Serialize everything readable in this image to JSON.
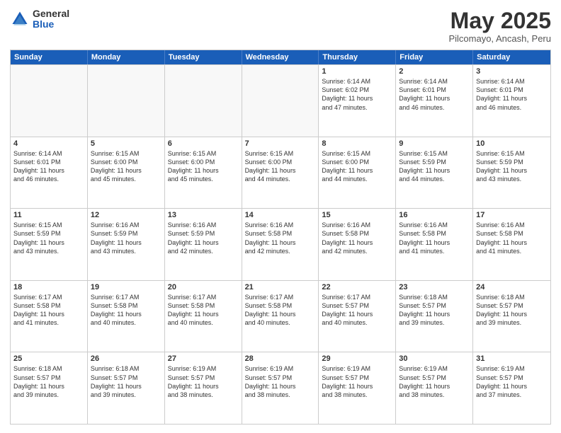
{
  "logo": {
    "general": "General",
    "blue": "Blue"
  },
  "title": "May 2025",
  "subtitle": "Pilcomayo, Ancash, Peru",
  "headers": [
    "Sunday",
    "Monday",
    "Tuesday",
    "Wednesday",
    "Thursday",
    "Friday",
    "Saturday"
  ],
  "weeks": [
    [
      {
        "day": "",
        "text": ""
      },
      {
        "day": "",
        "text": ""
      },
      {
        "day": "",
        "text": ""
      },
      {
        "day": "",
        "text": ""
      },
      {
        "day": "1",
        "text": "Sunrise: 6:14 AM\nSunset: 6:02 PM\nDaylight: 11 hours\nand 47 minutes."
      },
      {
        "day": "2",
        "text": "Sunrise: 6:14 AM\nSunset: 6:01 PM\nDaylight: 11 hours\nand 46 minutes."
      },
      {
        "day": "3",
        "text": "Sunrise: 6:14 AM\nSunset: 6:01 PM\nDaylight: 11 hours\nand 46 minutes."
      }
    ],
    [
      {
        "day": "4",
        "text": "Sunrise: 6:14 AM\nSunset: 6:01 PM\nDaylight: 11 hours\nand 46 minutes."
      },
      {
        "day": "5",
        "text": "Sunrise: 6:15 AM\nSunset: 6:00 PM\nDaylight: 11 hours\nand 45 minutes."
      },
      {
        "day": "6",
        "text": "Sunrise: 6:15 AM\nSunset: 6:00 PM\nDaylight: 11 hours\nand 45 minutes."
      },
      {
        "day": "7",
        "text": "Sunrise: 6:15 AM\nSunset: 6:00 PM\nDaylight: 11 hours\nand 44 minutes."
      },
      {
        "day": "8",
        "text": "Sunrise: 6:15 AM\nSunset: 6:00 PM\nDaylight: 11 hours\nand 44 minutes."
      },
      {
        "day": "9",
        "text": "Sunrise: 6:15 AM\nSunset: 5:59 PM\nDaylight: 11 hours\nand 44 minutes."
      },
      {
        "day": "10",
        "text": "Sunrise: 6:15 AM\nSunset: 5:59 PM\nDaylight: 11 hours\nand 43 minutes."
      }
    ],
    [
      {
        "day": "11",
        "text": "Sunrise: 6:15 AM\nSunset: 5:59 PM\nDaylight: 11 hours\nand 43 minutes."
      },
      {
        "day": "12",
        "text": "Sunrise: 6:16 AM\nSunset: 5:59 PM\nDaylight: 11 hours\nand 43 minutes."
      },
      {
        "day": "13",
        "text": "Sunrise: 6:16 AM\nSunset: 5:59 PM\nDaylight: 11 hours\nand 42 minutes."
      },
      {
        "day": "14",
        "text": "Sunrise: 6:16 AM\nSunset: 5:58 PM\nDaylight: 11 hours\nand 42 minutes."
      },
      {
        "day": "15",
        "text": "Sunrise: 6:16 AM\nSunset: 5:58 PM\nDaylight: 11 hours\nand 42 minutes."
      },
      {
        "day": "16",
        "text": "Sunrise: 6:16 AM\nSunset: 5:58 PM\nDaylight: 11 hours\nand 41 minutes."
      },
      {
        "day": "17",
        "text": "Sunrise: 6:16 AM\nSunset: 5:58 PM\nDaylight: 11 hours\nand 41 minutes."
      }
    ],
    [
      {
        "day": "18",
        "text": "Sunrise: 6:17 AM\nSunset: 5:58 PM\nDaylight: 11 hours\nand 41 minutes."
      },
      {
        "day": "19",
        "text": "Sunrise: 6:17 AM\nSunset: 5:58 PM\nDaylight: 11 hours\nand 40 minutes."
      },
      {
        "day": "20",
        "text": "Sunrise: 6:17 AM\nSunset: 5:58 PM\nDaylight: 11 hours\nand 40 minutes."
      },
      {
        "day": "21",
        "text": "Sunrise: 6:17 AM\nSunset: 5:58 PM\nDaylight: 11 hours\nand 40 minutes."
      },
      {
        "day": "22",
        "text": "Sunrise: 6:17 AM\nSunset: 5:57 PM\nDaylight: 11 hours\nand 40 minutes."
      },
      {
        "day": "23",
        "text": "Sunrise: 6:18 AM\nSunset: 5:57 PM\nDaylight: 11 hours\nand 39 minutes."
      },
      {
        "day": "24",
        "text": "Sunrise: 6:18 AM\nSunset: 5:57 PM\nDaylight: 11 hours\nand 39 minutes."
      }
    ],
    [
      {
        "day": "25",
        "text": "Sunrise: 6:18 AM\nSunset: 5:57 PM\nDaylight: 11 hours\nand 39 minutes."
      },
      {
        "day": "26",
        "text": "Sunrise: 6:18 AM\nSunset: 5:57 PM\nDaylight: 11 hours\nand 39 minutes."
      },
      {
        "day": "27",
        "text": "Sunrise: 6:19 AM\nSunset: 5:57 PM\nDaylight: 11 hours\nand 38 minutes."
      },
      {
        "day": "28",
        "text": "Sunrise: 6:19 AM\nSunset: 5:57 PM\nDaylight: 11 hours\nand 38 minutes."
      },
      {
        "day": "29",
        "text": "Sunrise: 6:19 AM\nSunset: 5:57 PM\nDaylight: 11 hours\nand 38 minutes."
      },
      {
        "day": "30",
        "text": "Sunrise: 6:19 AM\nSunset: 5:57 PM\nDaylight: 11 hours\nand 38 minutes."
      },
      {
        "day": "31",
        "text": "Sunrise: 6:19 AM\nSunset: 5:57 PM\nDaylight: 11 hours\nand 37 minutes."
      }
    ]
  ]
}
